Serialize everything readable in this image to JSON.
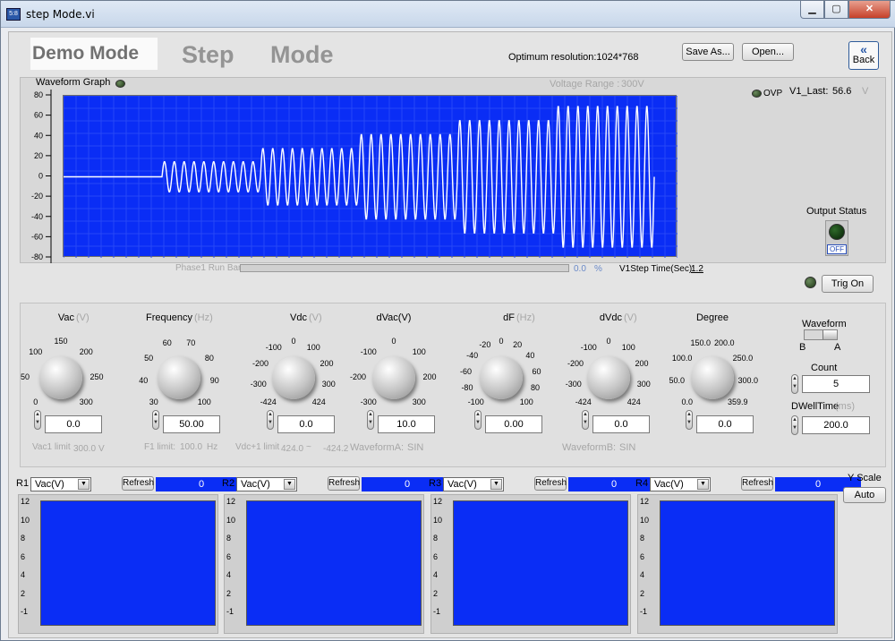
{
  "window": {
    "title": "step Mode.vi",
    "icon_text": "5:8",
    "min_glyph": "▁",
    "max_glyph": "▢",
    "close_glyph": "✕"
  },
  "header": {
    "demo_mode": "Demo Mode",
    "step": "Step",
    "mode": "Mode",
    "resolution": "Optimum resolution:1024*768",
    "save_as": "Save As...",
    "open": "Open...",
    "back": "Back",
    "back_glyph": "«"
  },
  "graph": {
    "title": "Waveform Graph",
    "voltage_range_label": "Voltage Range :",
    "voltage_range_value": "300V",
    "y_ticks": [
      "80",
      "60",
      "40",
      "20",
      "0",
      "-20",
      "-40",
      "-60",
      "-80"
    ],
    "ylim": [
      -80,
      80
    ],
    "ovp_label": "OVP",
    "v1_last_label": "V1_Last:",
    "v1_last_value": "56.6",
    "v1_last_unit": "V",
    "output_status_label": "Output Status",
    "output_switch": "OFF",
    "phase_bar_label": "Phase1 Run Bar",
    "phase_value": "0.0",
    "phase_unit": "%",
    "phase_progress": 0,
    "step_time_label": "V1Step Time(Sec):",
    "step_time_value": "1.2",
    "trig_on": "Trig On"
  },
  "knobs": [
    {
      "label": "Vac",
      "unit": "(V)",
      "ticks": [
        "0",
        "50",
        "100",
        "150",
        "200",
        "250",
        "300"
      ],
      "value": "0.0"
    },
    {
      "label": "Frequency",
      "unit": "(Hz)",
      "ticks": [
        "30",
        "40",
        "50",
        "60",
        "70",
        "80",
        "90",
        "100"
      ],
      "value": "50.00"
    },
    {
      "label": "Vdc",
      "unit": "(V)",
      "ticks": [
        "-424",
        "-300",
        "-200",
        "-100",
        "0",
        "100",
        "200",
        "300",
        "424"
      ],
      "value": "0.0"
    },
    {
      "label": "dVac(V)",
      "unit": "",
      "ticks": [
        "-300",
        "-200",
        "-100",
        "0",
        "100",
        "200",
        "300"
      ],
      "value": "10.0"
    },
    {
      "label": "dF",
      "unit": "(Hz)",
      "ticks": [
        "-100",
        "-80",
        "-60",
        "-40",
        "-20",
        "0",
        "20",
        "40",
        "60",
        "80",
        "100"
      ],
      "value": "0.00"
    },
    {
      "label": "dVdc",
      "unit": "(V)",
      "ticks": [
        "-424",
        "-300",
        "-200",
        "-100",
        "0",
        "100",
        "200",
        "300",
        "424"
      ],
      "value": "0.0"
    },
    {
      "label": "Degree",
      "unit": "",
      "ticks": [
        "0.0",
        "50.0",
        "100.0",
        "150.0",
        "200.0",
        "250.0",
        "300.0",
        "359.9"
      ],
      "value": "0.0"
    }
  ],
  "limits": {
    "vac1_label": "Vac1 limit",
    "vac1_value": "300.0",
    "vac1_unit": "V",
    "f1_label": "F1 limit:",
    "f1_value": "100.0",
    "f1_unit": "Hz",
    "vdc_label": "Vdc+1 limit",
    "vdc_min": "424.0",
    "vdc_sep": "~",
    "vdc_max": "-424.2",
    "wfa_label": "WaveformA:",
    "wfa_value": "SIN",
    "wfb_label": "WaveformB:",
    "wfb_value": "SIN"
  },
  "waveform_ctrl": {
    "label": "Waveform",
    "left": "B",
    "right": "A",
    "count_label": "Count",
    "count_value": "5",
    "dwell_label": "DWellTime",
    "dwell_unit": "(ms)",
    "dwell_value": "200.0"
  },
  "readbacks": [
    {
      "id": "R1",
      "select": "Vac(V)",
      "refresh": "Refresh",
      "value": "0"
    },
    {
      "id": "R2",
      "select": "Vac(V)",
      "refresh": "Refresh",
      "value": "0"
    },
    {
      "id": "R3",
      "select": "Vac(V)",
      "refresh": "Refresh",
      "value": "0"
    },
    {
      "id": "R4",
      "select": "Vac(V)",
      "refresh": "Refresh",
      "value": "0"
    }
  ],
  "mini_y_ticks": [
    "12",
    "10",
    "8",
    "6",
    "4",
    "2",
    "-1"
  ],
  "y_scale": {
    "label": "Y Scale",
    "button": "Auto"
  },
  "colors": {
    "plot_bg": "#0a2df5",
    "trace": "#ffffff"
  },
  "chart_data": {
    "type": "line",
    "title": "Waveform Graph",
    "ylim": [
      -80,
      80
    ],
    "y_ticks": [
      80,
      60,
      40,
      20,
      0,
      -20,
      -40,
      -60,
      -80
    ],
    "segments": [
      {
        "type": "flat",
        "amplitude": 0,
        "cycles": 0
      },
      {
        "type": "sine",
        "amplitude": 15,
        "cycles": 10
      },
      {
        "type": "sine",
        "amplitude": 28,
        "cycles": 10
      },
      {
        "type": "sine",
        "amplitude": 42,
        "cycles": 10
      },
      {
        "type": "sine",
        "amplitude": 56,
        "cycles": 10
      },
      {
        "type": "sine",
        "amplitude": 70,
        "cycles": 10
      }
    ]
  }
}
